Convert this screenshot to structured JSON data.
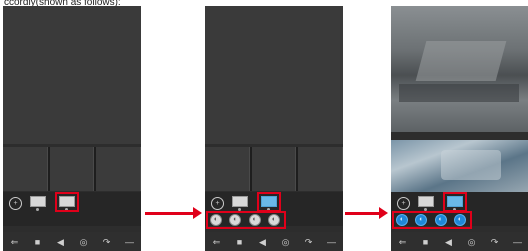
{
  "caption": "ccordly(shown as follows):",
  "phones": [
    {
      "ptz_glyph": "+",
      "nav_icons": [
        "⇐",
        "■",
        "◀",
        "◎",
        "↷",
        "—"
      ]
    },
    {
      "ptz_glyph": "+",
      "nav_icons": [
        "⇐",
        "■",
        "◀",
        "◎",
        "↷",
        "—"
      ]
    },
    {
      "ptz_glyph": "+",
      "nav_icons": [
        "⇐",
        "■",
        "◀",
        "◎",
        "↷",
        "—"
      ]
    }
  ],
  "colors": {
    "highlight": "#e0001a",
    "arrow": "#e0001a",
    "active_button": "#1e88d8",
    "active_split": "#6ab9e8"
  },
  "icon_names": [
    "ptz-icon",
    "split-screen-icon",
    "channel-icon",
    "back-icon",
    "record-icon",
    "audio-icon",
    "snapshot-icon",
    "rotate-icon",
    "more-icon"
  ]
}
